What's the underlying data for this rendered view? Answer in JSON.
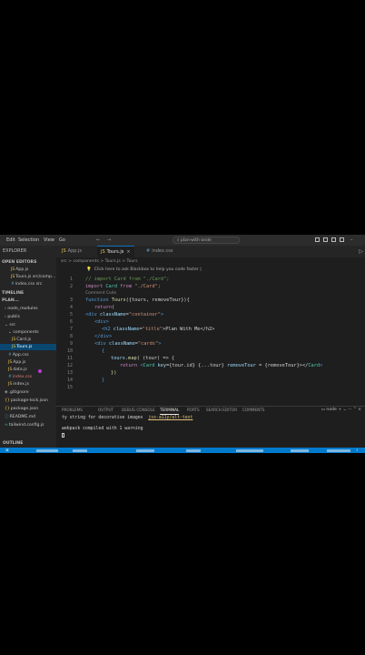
{
  "titlebar": {
    "menus": [
      "Edit",
      "Selection",
      "View",
      "Go"
    ],
    "nav_back": "←",
    "nav_forward": "→",
    "command_center": "plan-with-ande"
  },
  "tabs": {
    "explorer_label": "EXPLORER",
    "items": [
      {
        "label": "App.js",
        "icon": "js-file-icon"
      },
      {
        "label": "Tours.js",
        "icon": "js-file-icon",
        "close": "×"
      },
      {
        "label": "index.css",
        "icon": "css-file-icon"
      }
    ]
  },
  "sidebar": {
    "open_editors_label": "OPEN EDITORS",
    "open_editors": [
      "App.js",
      "Tours.js src/comp...",
      "index.css src"
    ],
    "timeline_label": "TIMELINE",
    "project_label": "PLAN...",
    "tree": [
      "node_modules",
      "public",
      "src",
      "components",
      "Card.js",
      "Tours.js",
      "App.css",
      "App.js",
      "data.js",
      "index.css",
      "index.js",
      ".gitignore",
      "package-lock.json",
      "package.json",
      "README.md",
      "tailwind.config.js"
    ],
    "outline_label": "OUTLINE"
  },
  "editor": {
    "breadcrumb": "src > components > Tours.js > Tours",
    "blackbox_hint": "Click here to ask Blackbox to help you code faster |",
    "line_numbers": [
      "1",
      "2",
      "3",
      "4",
      "5",
      "6",
      "7",
      "8",
      "9",
      "10",
      "11",
      "12",
      "13",
      "14",
      "15"
    ],
    "codelens": "Comment Code",
    "code": {
      "l1": "// import Card from \"./Card\";",
      "l2a": "import",
      "l2b": " Card ",
      "l2c": "from",
      "l2d": " \"./Card\";",
      "l3a": "function",
      "l3b": " Tours",
      "l3c": "({tours, removeTour}){",
      "l4a": "return",
      "l4b": "(",
      "l5a": "<div",
      "l5b": " className",
      "l5c": "=",
      "l5d": "\"container\"",
      "l5e": ">",
      "l6": "<div>",
      "l7a": "<h2",
      "l7b": " className",
      "l7c": "=",
      "l7d": "\"title\"",
      "l7e": ">Plan With Me</h2>",
      "l8": "</div>",
      "l9a": "<div",
      "l9b": " className",
      "l9c": "=",
      "l9d": "\"cards\"",
      "l9e": ">",
      "l10": "{",
      "l11a": "tours",
      "l11b": ".",
      "l11c": "map",
      "l11d": "( (tour) => {",
      "l12a": "return",
      "l12b": " <",
      "l12c": "Card",
      "l12d": " key",
      "l12e": "={tour.id} {...tour} ",
      "l12f": "removeTour",
      "l12g": " = {removeTour}></",
      "l12h": "Card",
      "l12i": ">",
      "l13": "})",
      "l14": "}"
    }
  },
  "panel": {
    "tabs": [
      "PROBLEMS",
      "OUTPUT",
      "DEBUG CONSOLE",
      "TERMINAL",
      "PORTS",
      "SEARCH EDITOR",
      "COMMENTS"
    ],
    "active_tab": "TERMINAL",
    "terminal_shell": "node",
    "terminal_lines": {
      "line1a": "ty string for decorative images  ",
      "line1b": "jsx-a11y/alt-text",
      "line2": "webpack compiled with 1 warning"
    }
  }
}
